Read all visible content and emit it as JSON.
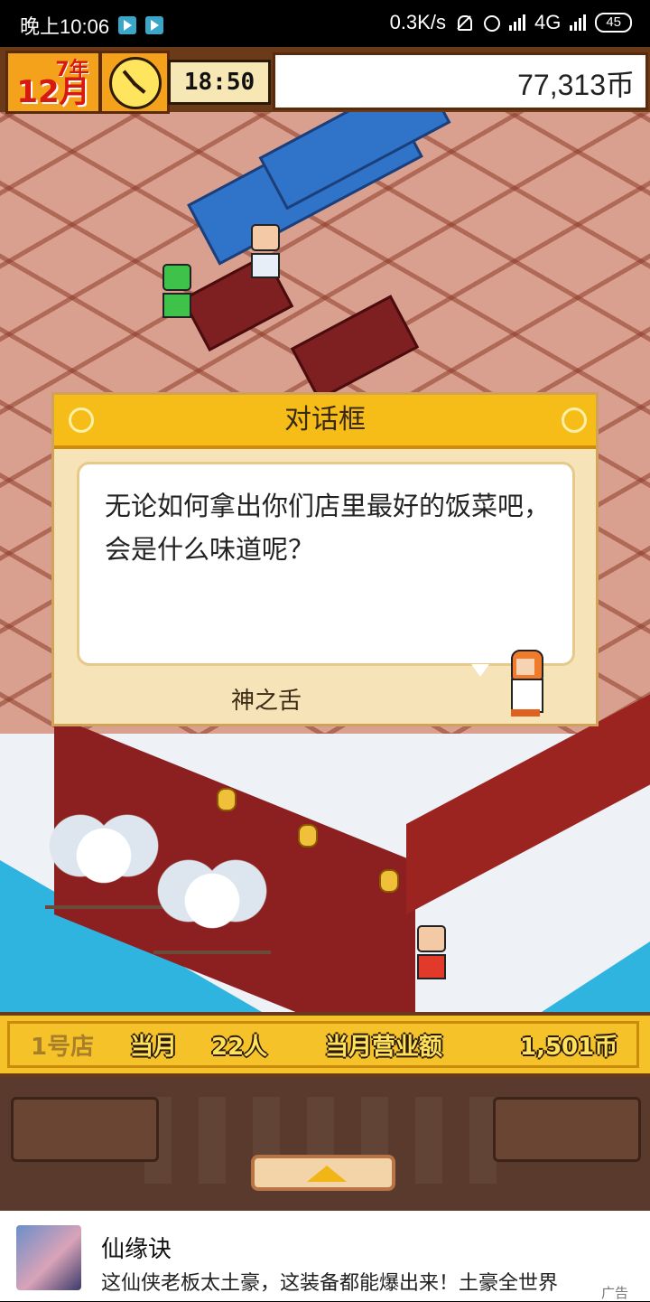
{
  "status_bar": {
    "time": "晚上10:06",
    "net_speed": "0.3K/s",
    "network": "4G",
    "battery": "45"
  },
  "hud": {
    "year": "7年",
    "month": "12月",
    "time": "18:50",
    "money": "77,313币"
  },
  "dialog": {
    "title": "对话框",
    "message": "无论如何拿出你们店里最好的饭菜吧，会是什么味道呢？",
    "speaker": "神之舌"
  },
  "status_strip": {
    "shop": "1号店",
    "month_label": "当月",
    "customers": "22人",
    "sales_label": "当月营业额",
    "sales": "1,501币"
  },
  "ad": {
    "title": "仙缘诀",
    "description": "这仙侠老板太土豪，这装备都能爆出来！土豪全世界",
    "tag": "广告"
  },
  "colors": {
    "hud_gold": "#f4a21b",
    "dialog_header": "#f6bd18",
    "strip": "#f6c22a",
    "panel": "#5a3a2c",
    "water": "#2fb4e0"
  }
}
